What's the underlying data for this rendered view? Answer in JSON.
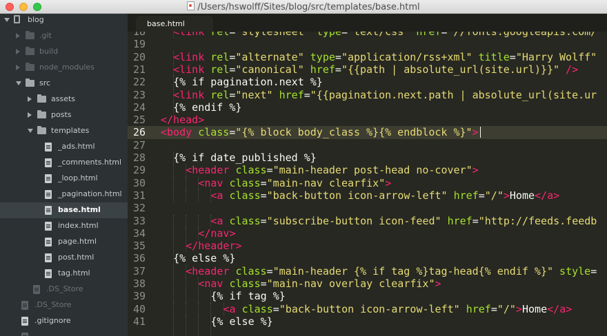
{
  "window": {
    "title": "/Users/hswolff/Sites/blog/src/templates/base.html"
  },
  "tab": {
    "label": "base.html"
  },
  "sidebar": {
    "items": [
      {
        "label": "blog",
        "type": "project",
        "indent": 0,
        "arrow": "down",
        "state": "normal"
      },
      {
        "label": ".git",
        "type": "folder",
        "indent": 1,
        "arrow": "right",
        "state": "dim"
      },
      {
        "label": "build",
        "type": "folder",
        "indent": 1,
        "arrow": "right",
        "state": "dim"
      },
      {
        "label": "node_modules",
        "type": "folder",
        "indent": 1,
        "arrow": "right",
        "state": "dim"
      },
      {
        "label": "src",
        "type": "folder",
        "indent": 1,
        "arrow": "down",
        "state": "normal"
      },
      {
        "label": "assets",
        "type": "folder",
        "indent": 2,
        "arrow": "right",
        "state": "normal"
      },
      {
        "label": "posts",
        "type": "folder-special",
        "indent": 2,
        "arrow": "right",
        "state": "normal"
      },
      {
        "label": "templates",
        "type": "folder",
        "indent": 2,
        "arrow": "down",
        "state": "normal"
      },
      {
        "label": "_ads.html",
        "type": "file",
        "indent": 3,
        "state": "normal"
      },
      {
        "label": "_comments.html",
        "type": "file",
        "indent": 3,
        "state": "normal"
      },
      {
        "label": "_loop.html",
        "type": "file",
        "indent": 3,
        "state": "normal"
      },
      {
        "label": "_pagination.html",
        "type": "file",
        "indent": 3,
        "state": "normal"
      },
      {
        "label": "base.html",
        "type": "file",
        "indent": 3,
        "state": "selected"
      },
      {
        "label": "index.html",
        "type": "file",
        "indent": 3,
        "state": "normal"
      },
      {
        "label": "page.html",
        "type": "file",
        "indent": 3,
        "state": "normal"
      },
      {
        "label": "post.html",
        "type": "file",
        "indent": 3,
        "state": "normal"
      },
      {
        "label": "tag.html",
        "type": "file",
        "indent": 3,
        "state": "normal"
      },
      {
        "label": ".DS_Store",
        "type": "file",
        "indent": 2,
        "state": "dim"
      },
      {
        "label": ".DS_Store",
        "type": "file",
        "indent": 1,
        "state": "dim"
      },
      {
        "label": ".gitignore",
        "type": "file",
        "indent": 1,
        "state": "normal"
      },
      {
        "label": "",
        "type": "file",
        "indent": 1,
        "state": "dim"
      }
    ]
  },
  "editor": {
    "current_line": 26,
    "cursor_line": 26,
    "lines": [
      {
        "num": "18",
        "indent": 1,
        "tokens": [
          [
            "tag",
            "<link "
          ],
          [
            "attr",
            "rel"
          ],
          [
            "eq",
            "="
          ],
          [
            "str",
            "\"stylesheet\" "
          ],
          [
            "attr",
            "type"
          ],
          [
            "eq",
            "="
          ],
          [
            "str",
            "\"text/css\" "
          ],
          [
            "attr",
            "href"
          ],
          [
            "eq",
            "="
          ],
          [
            "str",
            "\"//fonts.googleapis.com/"
          ]
        ]
      },
      {
        "num": "19",
        "indent": 0,
        "tokens": []
      },
      {
        "num": "20",
        "indent": 1,
        "tokens": [
          [
            "tag",
            "<link "
          ],
          [
            "attr",
            "rel"
          ],
          [
            "eq",
            "="
          ],
          [
            "str",
            "\"alternate\" "
          ],
          [
            "attr",
            "type"
          ],
          [
            "eq",
            "="
          ],
          [
            "str",
            "\"application/rss+xml\" "
          ],
          [
            "attr",
            "title"
          ],
          [
            "eq",
            "="
          ],
          [
            "str",
            "\"Harry Wolff\""
          ]
        ]
      },
      {
        "num": "21",
        "indent": 1,
        "tokens": [
          [
            "tag",
            "<link "
          ],
          [
            "attr",
            "rel"
          ],
          [
            "eq",
            "="
          ],
          [
            "str",
            "\"canonical\" "
          ],
          [
            "attr",
            "href"
          ],
          [
            "eq",
            "="
          ],
          [
            "str",
            "\"{{path | absolute_url(site.url)}}\" "
          ],
          [
            "tag",
            "/>"
          ]
        ]
      },
      {
        "num": "22",
        "indent": 1,
        "tokens": [
          [
            "plain",
            "{% if pagination.next %}"
          ]
        ]
      },
      {
        "num": "23",
        "indent": 1,
        "tokens": [
          [
            "tag",
            "<link "
          ],
          [
            "attr",
            "rel"
          ],
          [
            "eq",
            "="
          ],
          [
            "str",
            "\"next\" "
          ],
          [
            "attr",
            "href"
          ],
          [
            "eq",
            "="
          ],
          [
            "str",
            "\"{{pagination.next.path | absolute_url(site.ur"
          ]
        ]
      },
      {
        "num": "24",
        "indent": 1,
        "tokens": [
          [
            "plain",
            "{% endif %}"
          ]
        ]
      },
      {
        "num": "25",
        "indent": 0,
        "tokens": [
          [
            "tag",
            "</head>"
          ]
        ]
      },
      {
        "num": "26",
        "indent": 0,
        "tokens": [
          [
            "tag",
            "<body "
          ],
          [
            "attr",
            "class"
          ],
          [
            "eq",
            "="
          ],
          [
            "str",
            "\"{% block body_class %}{% endblock %}\""
          ],
          [
            "tag",
            ">"
          ]
        ]
      },
      {
        "num": "27",
        "indent": 0,
        "tokens": []
      },
      {
        "num": "28",
        "indent": 1,
        "tokens": [
          [
            "plain",
            "{% if date_published %}"
          ]
        ]
      },
      {
        "num": "29",
        "indent": 2,
        "tokens": [
          [
            "tag",
            "<header "
          ],
          [
            "attr",
            "class"
          ],
          [
            "eq",
            "="
          ],
          [
            "str",
            "\"main-header post-head no-cover\""
          ],
          [
            "tag",
            ">"
          ]
        ]
      },
      {
        "num": "30",
        "indent": 3,
        "tokens": [
          [
            "tag",
            "<nav "
          ],
          [
            "attr",
            "class"
          ],
          [
            "eq",
            "="
          ],
          [
            "str",
            "\"main-nav clearfix\""
          ],
          [
            "tag",
            ">"
          ]
        ]
      },
      {
        "num": "31",
        "indent": 4,
        "tokens": [
          [
            "tag",
            "<a "
          ],
          [
            "attr",
            "class"
          ],
          [
            "eq",
            "="
          ],
          [
            "str",
            "\"back-button icon-arrow-left\" "
          ],
          [
            "attr",
            "href"
          ],
          [
            "eq",
            "="
          ],
          [
            "str",
            "\"/\""
          ],
          [
            "tag",
            ">"
          ],
          [
            "plain",
            "Home"
          ],
          [
            "tag",
            "</a>"
          ]
        ]
      },
      {
        "num": "32",
        "indent": 0,
        "tokens": []
      },
      {
        "num": "33",
        "indent": 4,
        "tokens": [
          [
            "tag",
            "<a "
          ],
          [
            "attr",
            "class"
          ],
          [
            "eq",
            "="
          ],
          [
            "str",
            "\"subscribe-button icon-feed\" "
          ],
          [
            "attr",
            "href"
          ],
          [
            "eq",
            "="
          ],
          [
            "str",
            "\"http://feeds.feedb"
          ]
        ]
      },
      {
        "num": "34",
        "indent": 3,
        "tokens": [
          [
            "tag",
            "</nav>"
          ]
        ]
      },
      {
        "num": "35",
        "indent": 2,
        "tokens": [
          [
            "tag",
            "</header>"
          ]
        ]
      },
      {
        "num": "36",
        "indent": 1,
        "tokens": [
          [
            "plain",
            "{% else %}"
          ]
        ]
      },
      {
        "num": "37",
        "indent": 2,
        "tokens": [
          [
            "tag",
            "<header "
          ],
          [
            "attr",
            "class"
          ],
          [
            "eq",
            "="
          ],
          [
            "str",
            "\"main-header {% if tag %}tag-head{% endif %}\" "
          ],
          [
            "attr",
            "style"
          ],
          [
            "eq",
            "="
          ]
        ]
      },
      {
        "num": "38",
        "indent": 3,
        "tokens": [
          [
            "tag",
            "<nav "
          ],
          [
            "attr",
            "class"
          ],
          [
            "eq",
            "="
          ],
          [
            "str",
            "\"main-nav overlay clearfix\""
          ],
          [
            "tag",
            ">"
          ]
        ]
      },
      {
        "num": "39",
        "indent": 4,
        "tokens": [
          [
            "plain",
            "{% if tag %}"
          ]
        ]
      },
      {
        "num": "40",
        "indent": 5,
        "tokens": [
          [
            "tag",
            "<a "
          ],
          [
            "attr",
            "class"
          ],
          [
            "eq",
            "="
          ],
          [
            "str",
            "\"back-button icon-arrow-left\" "
          ],
          [
            "attr",
            "href"
          ],
          [
            "eq",
            "="
          ],
          [
            "str",
            "\"/\""
          ],
          [
            "tag",
            ">"
          ],
          [
            "plain",
            "Home"
          ],
          [
            "tag",
            "</a>"
          ]
        ]
      },
      {
        "num": "41",
        "indent": 4,
        "tokens": [
          [
            "plain",
            "{% else %}"
          ]
        ]
      },
      {
        "num": "",
        "indent": 5,
        "tokens": []
      }
    ]
  }
}
